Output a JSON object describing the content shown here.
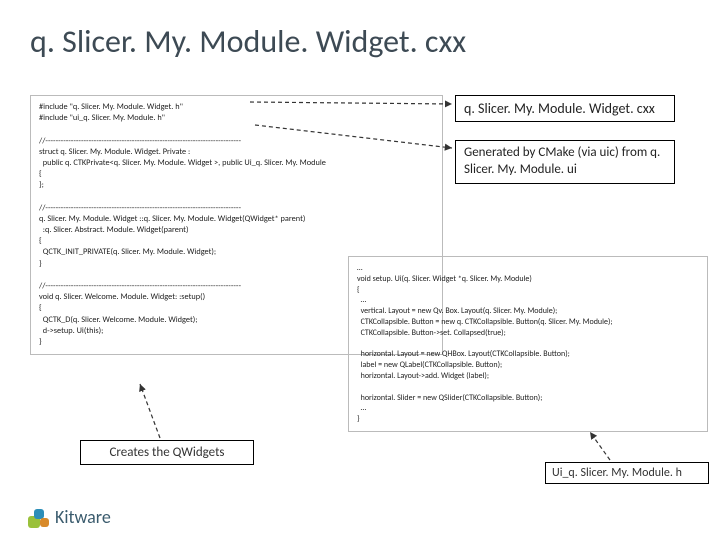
{
  "title": "q. Slicer. My. Module. Widget. cxx",
  "code_main": "#include \"q. Slicer. My. Module. Widget. h\"\n#include \"ui_q. Slicer. My. Module. h\"\n\n//-----------------------------------------------------------------------------\nstruct q. Slicer. My. Module. Widget. Private :\n  public q. CTKPrivate<q. Slicer. My. Module. Widget >, public Ui_q. Slicer. My. Module\n{\n};\n\n//-----------------------------------------------------------------------------\nq. Slicer. My. Module. Widget ::q. Slicer. My. Module. Widget(QWidget* parent)\n  :q. Slicer. Abstract. Module. Widget(parent)\n{\n  QCTK_INIT_PRIVATE(q. Slicer. My. Module. Widget);\n}\n\n//-----------------------------------------------------------------------------\nvoid q. Slicer. Welcome. Module. Widget: :setup()\n{\n  QCTK_D(q. Slicer. Welcome. Module. Widget);\n  d->setup. Ui(this);\n}",
  "side_a": "q. Slicer. My. Module. Widget. cxx",
  "side_b": "Generated by CMake (via uic) from q. Slicer. My. Module. ui",
  "callout_c": "Creates the QWidgets",
  "code2": "…\nvoid setup. Ui(q. Slicer. Widget *q. Slicer. My. Module)\n{\n  …\n  vertical. Layout = new Qv. Box. Layout(q. Slicer. My. Module);\n  CTKCollapsible. Button = new q. CTKCollapsible. Button(q. Slicer. My. Module);\n  CTKCollapsible. Button->set. Collapsed(true);\n\n  horizontal. Layout = new QHBox. Layout(CTKCollapsible. Button);\n  label = new QLabel(CTKCollapsible. Button);\n  horizontal. Layout->add. Widget (label);\n\n  horizontal. Slider = new QSlider(CTKCollapsible. Button);\n  …\n}",
  "callout_d": "Ui_q. Slicer. My. Module. h",
  "logo_text": "Kitware"
}
